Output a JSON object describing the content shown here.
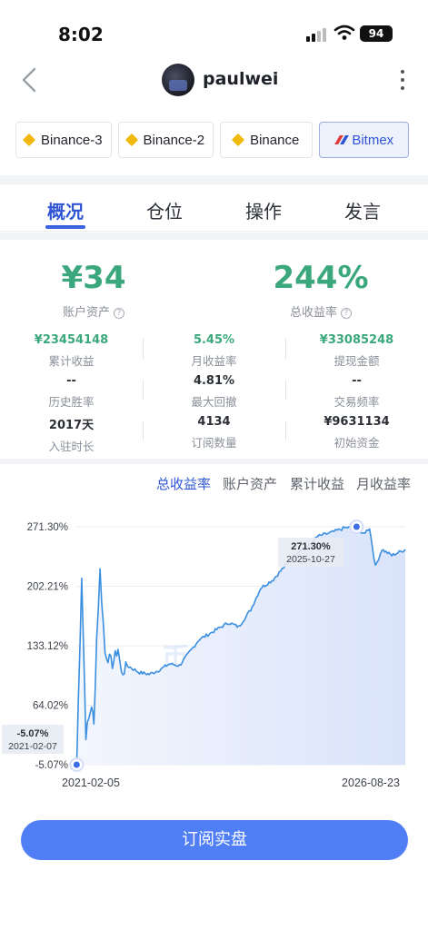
{
  "status_bar": {
    "time": "8:02",
    "battery": "94"
  },
  "header": {
    "username": "paulwei"
  },
  "exchanges": [
    {
      "label": "Binance-3",
      "icon": "binance-icon",
      "active": false
    },
    {
      "label": "Binance-2",
      "icon": "binance-icon",
      "active": false
    },
    {
      "label": "Binance",
      "icon": "binance-icon",
      "active": false
    },
    {
      "label": "Bitmex",
      "icon": "bitmex-icon",
      "active": true
    }
  ],
  "tabs": [
    {
      "label": "概况",
      "active": true
    },
    {
      "label": "仓位",
      "active": false
    },
    {
      "label": "操作",
      "active": false
    },
    {
      "label": "发言",
      "active": false
    }
  ],
  "summary": {
    "assets_value": "¥34",
    "assets_label": "账户资产",
    "return_value": "244%",
    "return_label": "总收益率"
  },
  "stats": [
    {
      "value": "¥23454148",
      "label": "累计收益",
      "green": true
    },
    {
      "value": "5.45%",
      "label": "月收益率",
      "green": true
    },
    {
      "value": "¥33085248",
      "label": "提现金额",
      "green": true
    },
    {
      "value": "--",
      "label": "历史胜率",
      "green": false
    },
    {
      "value": "4.81%",
      "label": "最大回撤",
      "green": false
    },
    {
      "value": "--",
      "label": "交易频率",
      "green": false
    },
    {
      "value": "2017天",
      "label": "入驻时长",
      "green": false
    },
    {
      "value": "4134",
      "label": "订阅数量",
      "green": false
    },
    {
      "value": "¥9631134",
      "label": "初始资金",
      "green": false
    }
  ],
  "chart_filters": [
    {
      "label": "总收益率",
      "active": true
    },
    {
      "label": "账户资产",
      "active": false
    },
    {
      "label": "累计收益",
      "active": false
    },
    {
      "label": "月收益率",
      "active": false
    }
  ],
  "chart_data": {
    "type": "area",
    "ytick_labels": [
      "271.30%",
      "202.21%",
      "133.12%",
      "64.02%",
      "-5.07%"
    ],
    "yticks": [
      271.3,
      202.21,
      133.12,
      64.02,
      -5.07
    ],
    "ylim": [
      -5.07,
      271.3
    ],
    "xtick_labels": [
      "2021-02-05",
      "2026-08-23"
    ],
    "watermark": "币COIN",
    "colors": {
      "line": "#3b8fe0",
      "fill": "#dfe7fb",
      "marker": "#3f6fe6"
    },
    "series": [
      {
        "x": [
          "2021-02-05",
          "2021-02-07",
          "2021-03-10",
          "2021-04-05",
          "2021-05-10",
          "2021-05-24",
          "2021-06-10",
          "2021-07-01",
          "2021-08-01",
          "2021-09-15",
          "2021-10-20",
          "2021-11-10",
          "2021-12-15",
          "2022-03-01",
          "2022-05-01",
          "2022-07-01",
          "2022-09-01",
          "2022-11-01",
          "2023-01-01",
          "2023-03-01",
          "2023-06-01",
          "2023-09-01",
          "2023-11-01",
          "2024-01-15",
          "2024-03-15",
          "2024-06-01",
          "2024-09-01",
          "2024-11-15",
          "2025-01-10",
          "2025-03-01",
          "2025-06-01",
          "2025-08-15",
          "2025-10-27",
          "2025-12-01",
          "2026-01-15",
          "2026-02-20",
          "2026-04-01",
          "2026-06-01",
          "2026-08-23"
        ],
        "y": [
          -5.07,
          -5.07,
          215.0,
          30.0,
          65.0,
          40.0,
          140.0,
          220.0,
          125.0,
          112.0,
          130.0,
          100.0,
          110.0,
          102.0,
          100.0,
          105.0,
          112.0,
          110.0,
          125.0,
          140.0,
          150.0,
          160.0,
          155.0,
          175.0,
          200.0,
          210.0,
          230.0,
          245.0,
          250.0,
          260.0,
          265.0,
          270.0,
          271.3,
          262.0,
          270.0,
          225.0,
          245.0,
          238.0,
          245.0
        ]
      }
    ],
    "markers": [
      {
        "x": "2021-02-07",
        "y_label": "-5.07%",
        "date_label": "2021-02-07"
      },
      {
        "x": "2025-10-27",
        "y_label": "271.30%",
        "date_label": "2025-10-27"
      }
    ]
  },
  "subscribe_button": {
    "label": "订阅实盘"
  }
}
